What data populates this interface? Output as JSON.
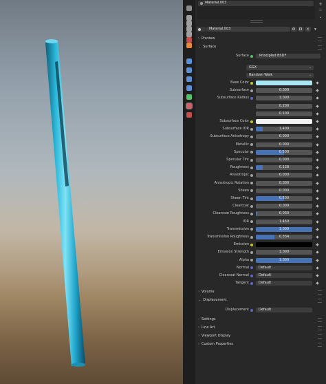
{
  "header": {
    "material_slot": "Material.003",
    "material_name": "Material.003",
    "minus_button": "−"
  },
  "sections": {
    "preview": "Preview",
    "surface": "Surface",
    "volume": "Volume",
    "displacement": "Displacement",
    "settings": "Settings",
    "line_art": "Line Art",
    "viewport_display": "Viewport Display",
    "custom_properties": "Custom Properties"
  },
  "surface": {
    "surface_label": "Surface",
    "shader": "Principled BSDF",
    "distribution": "GGX",
    "subsurface_method": "Random Walk",
    "rows": [
      {
        "label": "Base Color",
        "type": "color",
        "dot": "#c7c729",
        "color": "#a9e7f5"
      },
      {
        "label": "Subsurface",
        "type": "value",
        "dot": "#a1a1a1",
        "value": "0.000",
        "fill": 0
      },
      {
        "label": "Subsurface Radius",
        "type": "value",
        "dot": "#6363c7",
        "value": "1.000",
        "fill": 0
      },
      {
        "label": "",
        "type": "value",
        "dot": "",
        "value": "0.200",
        "fill": 0
      },
      {
        "label": "",
        "type": "value",
        "dot": "",
        "value": "0.100",
        "fill": 0
      },
      {
        "label": "Subsurface Color",
        "type": "color",
        "dot": "#c7c729",
        "color": "#f2f2f2"
      },
      {
        "label": "Subsurface IOR",
        "type": "value",
        "dot": "#a1a1a1",
        "value": "1.400",
        "fill": 0.12
      },
      {
        "label": "Subsurface Anisotropy",
        "type": "value",
        "dot": "#a1a1a1",
        "value": "0.000",
        "fill": 0
      },
      {
        "label": "Metallic",
        "type": "value",
        "dot": "#a1a1a1",
        "value": "0.000",
        "fill": 0
      },
      {
        "label": "Specular",
        "type": "value",
        "dot": "#a1a1a1",
        "value": "0.500",
        "fill": 0.5
      },
      {
        "label": "Specular Tint",
        "type": "value",
        "dot": "#a1a1a1",
        "value": "0.000",
        "fill": 0
      },
      {
        "label": "Roughness",
        "type": "value",
        "dot": "#a1a1a1",
        "value": "0.128",
        "fill": 0.128
      },
      {
        "label": "Anisotropic",
        "type": "value",
        "dot": "#a1a1a1",
        "value": "0.000",
        "fill": 0
      },
      {
        "label": "Anisotropic Rotation",
        "type": "value",
        "dot": "#a1a1a1",
        "value": "0.000",
        "fill": 0
      },
      {
        "label": "Sheen",
        "type": "value",
        "dot": "#a1a1a1",
        "value": "0.000",
        "fill": 0
      },
      {
        "label": "Sheen Tint",
        "type": "value",
        "dot": "#a1a1a1",
        "value": "0.500",
        "fill": 0.5
      },
      {
        "label": "Clearcoat",
        "type": "value",
        "dot": "#a1a1a1",
        "value": "0.000",
        "fill": 0
      },
      {
        "label": "Clearcoat Roughness",
        "type": "value",
        "dot": "#a1a1a1",
        "value": "0.030",
        "fill": 0.03
      },
      {
        "label": "IOR",
        "type": "value",
        "dot": "#a1a1a1",
        "value": "1.450",
        "fill": 0
      },
      {
        "label": "Transmission",
        "type": "value",
        "dot": "#a1a1a1",
        "value": "1.000",
        "fill": 1
      },
      {
        "label": "Transmission Roughness",
        "type": "value",
        "dot": "#a1a1a1",
        "value": "0.334",
        "fill": 0.334
      },
      {
        "label": "Emission",
        "type": "color",
        "dot": "#c7c729",
        "color": "#000000"
      },
      {
        "label": "Emission Strength",
        "type": "value",
        "dot": "#a1a1a1",
        "value": "1.000",
        "fill": 0
      },
      {
        "label": "Alpha",
        "type": "value",
        "dot": "#a1a1a1",
        "value": "1.000",
        "fill": 1
      },
      {
        "label": "Normal",
        "type": "link",
        "dot": "#6363c7",
        "value": "Default"
      },
      {
        "label": "Clearcoat Normal",
        "type": "link",
        "dot": "#6363c7",
        "value": "Default"
      },
      {
        "label": "Tangent",
        "type": "link",
        "dot": "#6363c7",
        "value": "Default"
      }
    ]
  },
  "displacement": {
    "label": "Displacement",
    "value": "Default",
    "dot": "#6363c7"
  },
  "tab_icons": [
    {
      "name": "tool-icon",
      "color": "#8a8a8a"
    },
    {
      "name": "render-icon",
      "color": "#a0a0a0"
    },
    {
      "name": "output-icon",
      "color": "#a0a0a0"
    },
    {
      "name": "view-layer-icon",
      "color": "#a0a0a0"
    },
    {
      "name": "scene-icon",
      "color": "#a0a0a0"
    },
    {
      "name": "world-icon",
      "color": "#c44d4d"
    },
    {
      "name": "object-icon",
      "color": "#e8883a"
    },
    {
      "name": "modifiers-icon",
      "color": "#5b8fd6"
    },
    {
      "name": "particles-icon",
      "color": "#5b8fd6"
    },
    {
      "name": "physics-icon",
      "color": "#5b8fd6"
    },
    {
      "name": "constraints-icon",
      "color": "#5b8fd6"
    },
    {
      "name": "data-icon",
      "color": "#4fc46a"
    },
    {
      "name": "material-icon",
      "color": "#d0606a"
    },
    {
      "name": "texture-icon",
      "color": "#c44d4d"
    }
  ],
  "colors": {
    "accent": "#4772b3",
    "panel_bg": "#282828",
    "field_bg": "#545454"
  }
}
